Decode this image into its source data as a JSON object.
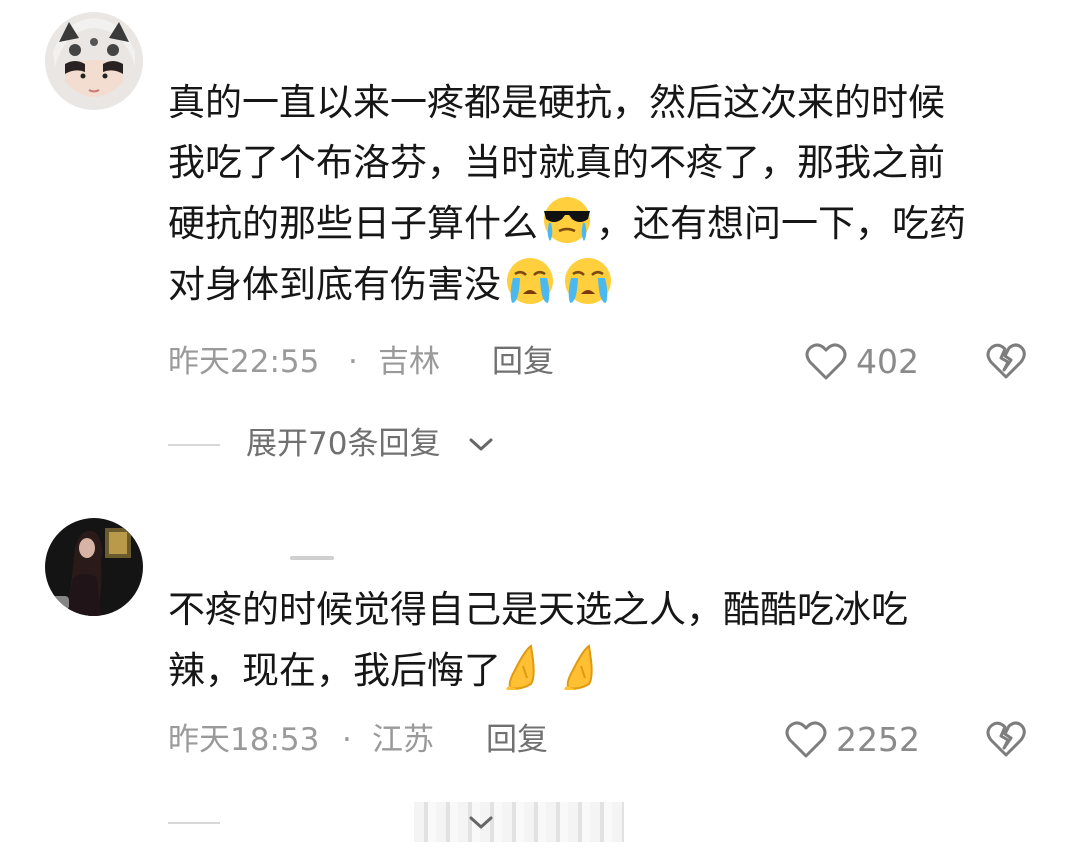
{
  "comments": [
    {
      "text_line1": "真的一直以来一疼都是硬抗，然后这次来的时候",
      "text_line2": "我吃了个布洛芬，当时就真的不疼了，那我之前",
      "text_line3a": "硬抗的那些日子算什么",
      "text_line3b": "，还有想问一下，吃药",
      "text_line4": "对身体到底有伤害没",
      "time": "昨天22:55",
      "dot": "·",
      "location": "吉林",
      "reply_label": "回复",
      "likes": "402",
      "expand_label": "展开70条回复"
    },
    {
      "text_line1": "不疼的时候觉得自己是天选之人，酷酷吃冰吃",
      "text_line2": "辣，现在，我后悔了",
      "time": "昨天18:53",
      "dot": "·",
      "location": "江苏",
      "reply_label": "回复",
      "likes": "2252"
    }
  ],
  "icons": {
    "heart": "heart-outline-icon",
    "dislike": "broken-heart-icon",
    "chevron": "chevron-down-icon",
    "emoji_cool_cry": "sunglasses-crying-emoji",
    "emoji_cry": "loudly-crying-emoji",
    "emoji_pray": "folded-hands-emoji"
  },
  "colors": {
    "text": "#161616",
    "meta": "#9a9a9a",
    "reply": "#707070"
  }
}
